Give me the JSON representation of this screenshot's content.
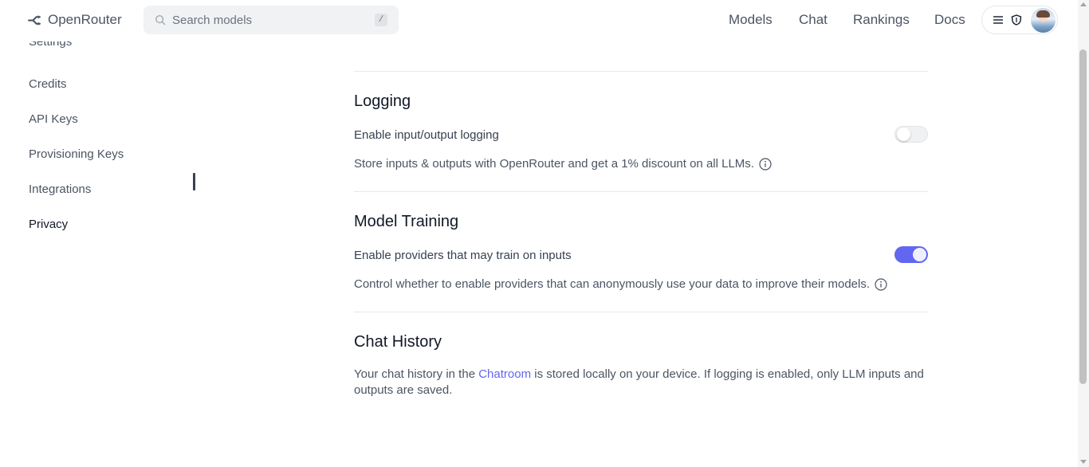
{
  "header": {
    "brand": "OpenRouter",
    "search_placeholder": "Search models",
    "search_shortcut": "/",
    "nav": [
      "Models",
      "Chat",
      "Rankings",
      "Docs"
    ]
  },
  "sidebar": {
    "items": [
      {
        "label": "Settings"
      },
      {
        "label": "Credits"
      },
      {
        "label": "API Keys"
      },
      {
        "label": "Provisioning Keys"
      },
      {
        "label": "Integrations"
      },
      {
        "label": "Privacy"
      }
    ]
  },
  "sections": {
    "logging": {
      "title": "Logging",
      "toggle_label": "Enable input/output logging",
      "toggle_on": false,
      "description": "Store inputs & outputs with OpenRouter and get a 1% discount on all LLMs."
    },
    "training": {
      "title": "Model Training",
      "toggle_label": "Enable providers that may train on inputs",
      "toggle_on": true,
      "description": "Control whether to enable providers that can anonymously use your data to improve their models."
    },
    "chat_history": {
      "title": "Chat History",
      "text_before": "Your chat history in the ",
      "link": "Chatroom",
      "text_after": " is stored locally on your device. If logging is enabled, only LLM inputs and outputs are saved."
    }
  },
  "colors": {
    "accent": "#6366f1",
    "text": "#111827",
    "muted": "#4b5563"
  },
  "icons": [
    "logo-icon",
    "search-icon",
    "menu-icon",
    "shield-icon",
    "info-icon"
  ]
}
